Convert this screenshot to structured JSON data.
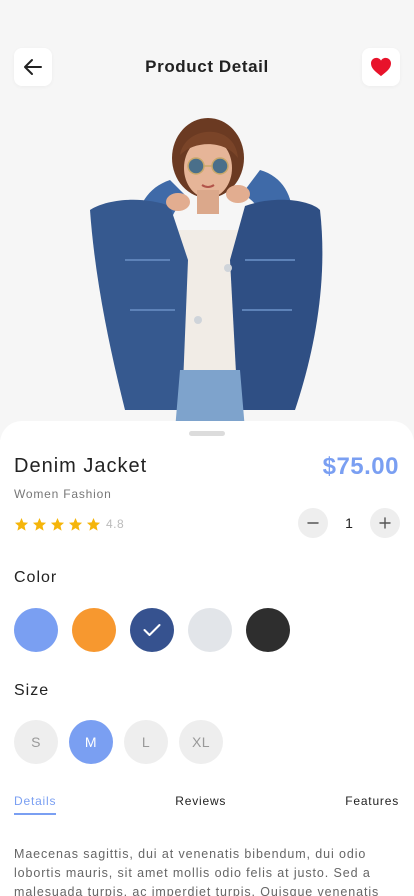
{
  "header": {
    "title": "Product Detail",
    "back_icon": "arrow-left-icon",
    "favorite_icon": "heart-icon",
    "favorite_color": "#e8132b"
  },
  "product": {
    "name": "Denim Jacket",
    "price": "$75.00",
    "category": "Women Fashion",
    "rating": "4.8",
    "stars_filled": 5,
    "quantity": "1",
    "minus_icon": "minus-icon",
    "plus_icon": "plus-icon"
  },
  "color_section": {
    "label": "Color",
    "options": [
      {
        "hex": "#7a9ff2",
        "selected": false
      },
      {
        "hex": "#f7982f",
        "selected": false
      },
      {
        "hex": "#36528f",
        "selected": true
      },
      {
        "hex": "#e2e5e9",
        "selected": false
      },
      {
        "hex": "#2e2e2e",
        "selected": false
      }
    ]
  },
  "size_section": {
    "label": "Size",
    "options": [
      {
        "label": "S",
        "selected": false
      },
      {
        "label": "M",
        "selected": true
      },
      {
        "label": "L",
        "selected": false
      },
      {
        "label": "XL",
        "selected": false
      }
    ]
  },
  "tabs": [
    {
      "label": "Details",
      "active": true
    },
    {
      "label": "Reviews",
      "active": false
    },
    {
      "label": "Features",
      "active": false
    }
  ],
  "description": "Maecenas sagittis, dui at venenatis bibendum, dui odio lobortis mauris, sit amet mollis odio felis at justo. Sed a malesuada turpis, ac imperdiet turpis. Quisque venenatis",
  "colors": {
    "accent": "#7a9ff2",
    "star": "#f5b50a",
    "chip_bg": "#eeeeee",
    "chip_text": "#999999"
  }
}
